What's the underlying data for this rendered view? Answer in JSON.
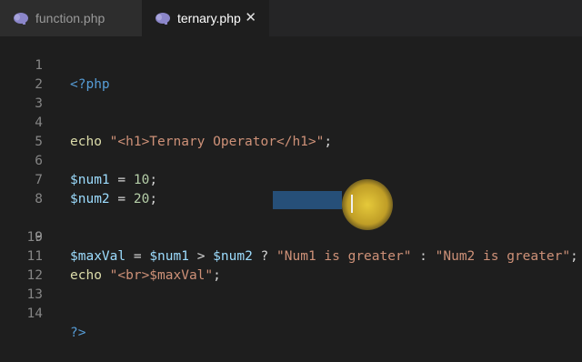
{
  "tabs": [
    {
      "label": "function.php",
      "icon": "php-elephant-icon",
      "active": false
    },
    {
      "label": "ternary.php",
      "icon": "php-elephant-icon",
      "active": true,
      "close": "✕"
    }
  ],
  "editor": {
    "active_line": 9,
    "lines": [
      {
        "n": "1"
      },
      {
        "n": "2"
      },
      {
        "n": "3"
      },
      {
        "n": "4"
      },
      {
        "n": "5"
      },
      {
        "n": "6"
      },
      {
        "n": "7"
      },
      {
        "n": "8"
      },
      {
        "n": "9"
      },
      {
        "n": "10"
      },
      {
        "n": "11"
      },
      {
        "n": "12"
      },
      {
        "n": "13"
      },
      {
        "n": "14"
      }
    ],
    "code": {
      "l1_open": "<?php",
      "l4_kw": "echo",
      "l4_str": "\"<h1>Ternary Operator</h1>\"",
      "l4_end": ";",
      "l6_var": "$num1",
      "l6_op": " = ",
      "l6_num": "10",
      "l6_end": ";",
      "l7_var": "$num2",
      "l7_op": " = ",
      "l7_num": "20",
      "l7_end": ";",
      "l9_var1": "$maxVal",
      "l9_op1": " = ",
      "l9_var2": "$num1",
      "l9_op2": " > ",
      "l9_var3": "$num2",
      "l9_op3": " ? ",
      "l9_str1": "\"Num1 is greater\"",
      "l9_op4": " : ",
      "l9_str2": "\"Num2 is greater\"",
      "l9_end": ";",
      "l11_kw": "echo",
      "l11_str": "\"<br>$maxVal\"",
      "l11_end": ";",
      "l14_close": "?>"
    }
  },
  "colors": {
    "background": "#1e1e1e",
    "tag": "#569cd6",
    "string": "#ce9178",
    "variable": "#9cdcfe",
    "selection": "#264f78",
    "cursor_highlight": "#e8c83a"
  }
}
